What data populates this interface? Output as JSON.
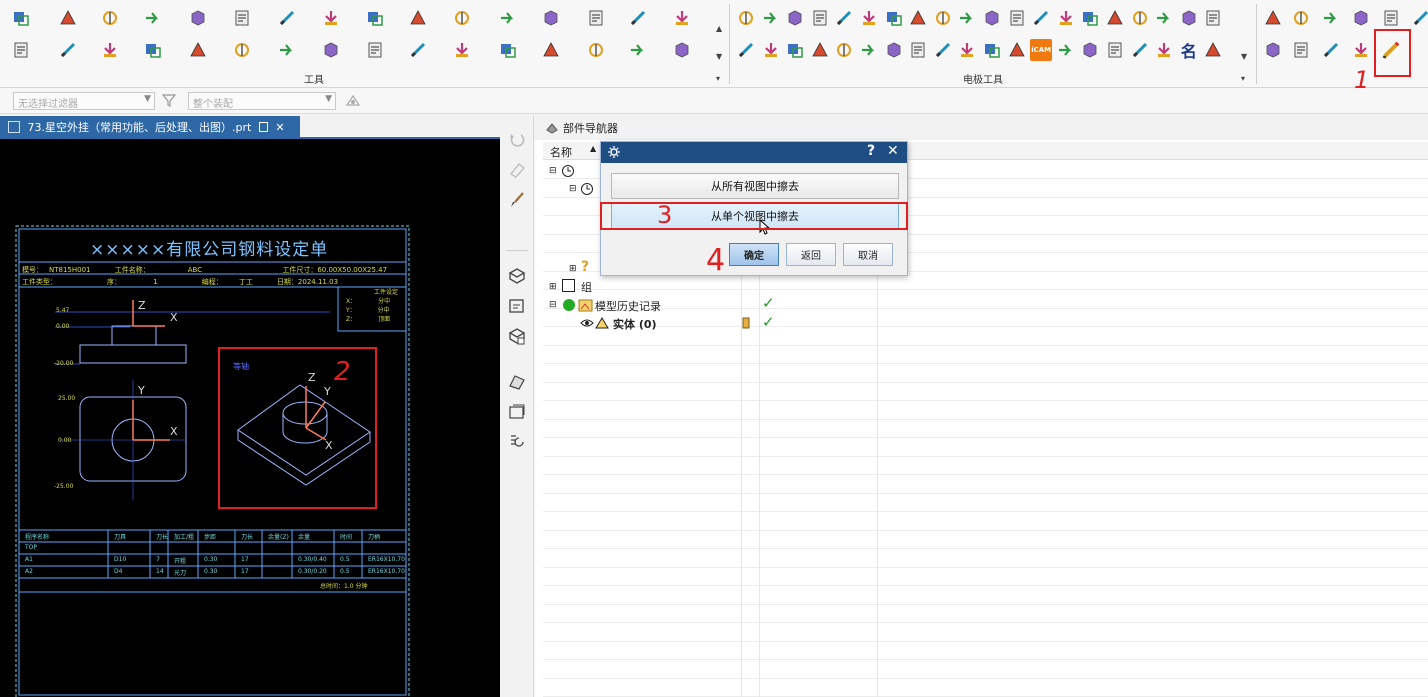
{
  "ribbon": {
    "group_tools_label": "工具",
    "group_electrode_label": "电极工具",
    "icam_label": "iCAM",
    "ming_label": "名"
  },
  "filterbar": {
    "filter_placeholder": "无选择过滤器",
    "assembly_placeholder": "整个装配"
  },
  "document_tab": {
    "title": "73.星空外挂（常用功能、后处理、出图）.prt",
    "close_glyph": "✕"
  },
  "cad_sheet": {
    "title": "×××××有限公司钢料设定单",
    "header_row1": [
      "模号：",
      "NT815H001",
      "工件名称：",
      "ABC",
      "工件尺寸：60.00X50.00X25.47"
    ],
    "header_row2": [
      "工件类型：",
      "序：",
      "1",
      "编程：",
      "丁工",
      "日期：2024.11.03"
    ],
    "side_box": [
      "工件设定",
      "X：",
      "分中",
      "Y：",
      "分中",
      "Z：",
      "顶面"
    ],
    "dims": [
      "5.47",
      "0.00",
      "-20.00",
      "25.00",
      "0.00",
      "-25.00"
    ],
    "view_label": "等轴",
    "axes": {
      "x": "X",
      "y": "Y",
      "z": "Z"
    },
    "table_headers": [
      "程序名称",
      "刀具",
      "刀长",
      "加工/粗",
      "步距",
      "刀长",
      "余量(Z)",
      "余量",
      "时间",
      "刀柄"
    ],
    "table_rows": [
      [
        "TOP",
        "",
        "",
        "",
        "",
        "",
        "",
        "",
        "",
        ""
      ],
      [
        "A1",
        "D10",
        "7",
        "开粗",
        "0.30",
        "17",
        "",
        "0.30/0.40",
        "0.5",
        "ER16X10.70"
      ],
      [
        "A2",
        "D4",
        "14",
        "光刀",
        "0.30",
        "17",
        "",
        "0.30/0.20",
        "0.5",
        "ER16X10.70"
      ]
    ],
    "total": "总时间：1.0 分钟"
  },
  "part_navigator": {
    "title": "部件导航器",
    "col_name": "名称",
    "row_group": "组",
    "row_history": "模型历史记录",
    "row_body": "实体 (0)",
    "check": "✓"
  },
  "dialog": {
    "help_glyph": "?",
    "close_glyph": "✕",
    "btn_erase_all": "从所有视图中擦去",
    "btn_erase_single": "从单个视图中擦去",
    "btn_ok": "确定",
    "btn_back": "返回",
    "btn_cancel": "取消"
  },
  "annotations": [
    "1",
    "2",
    "3",
    "4"
  ],
  "colors": {
    "accent": "#1f4e84",
    "annotation": "#e02020",
    "canvas": "#000000"
  }
}
